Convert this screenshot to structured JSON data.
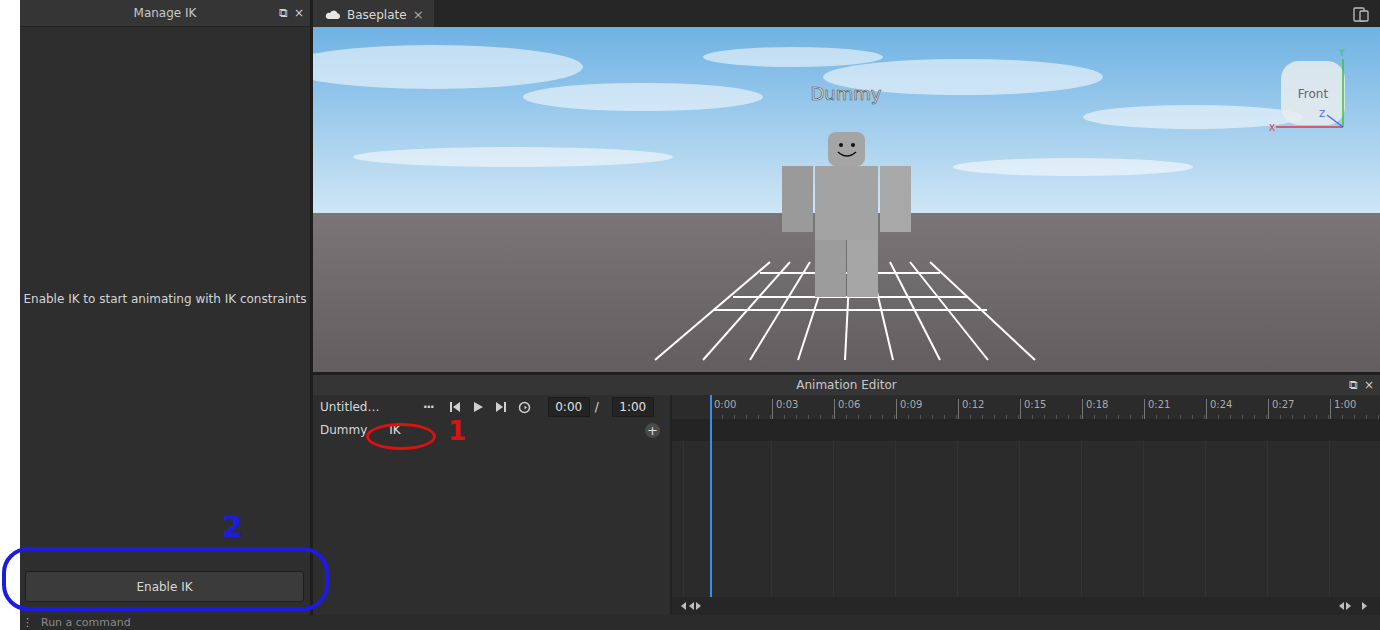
{
  "manage_ik": {
    "title": "Manage IK",
    "window_icons": [
      "⧉",
      "×"
    ],
    "message": "Enable IK to start animating with IK constraints",
    "button": "Enable IK"
  },
  "tabs": [
    {
      "label": "Baseplate",
      "selected": true,
      "close": "×"
    }
  ],
  "viewport": {
    "character_label": "Dummy",
    "view_cube": "Front",
    "axes": [
      {
        "label": "X",
        "color": "#e03a3a"
      },
      {
        "label": "Y",
        "color": "#3ac43a"
      },
      {
        "label": "Z",
        "color": "#4a6cf0"
      }
    ]
  },
  "animation_editor": {
    "title": "Animation Editor",
    "window_icons": [
      "⧉",
      "×"
    ],
    "animation_name": "Untitled…",
    "more": "···",
    "current_time": "0:00",
    "separator": "/",
    "end_time": "1:00",
    "ticks": [
      "0:00",
      "0:03",
      "0:06",
      "0:09",
      "0:12",
      "0:15",
      "0:18",
      "0:21",
      "0:24",
      "0:27",
      "1:00"
    ],
    "tracks": [
      {
        "name": "Dummy",
        "ik_label": "IK",
        "add": "+"
      }
    ]
  },
  "annotations": [
    {
      "label": "1",
      "color": "#e01010"
    },
    {
      "label": "2",
      "color": "#1c1ce0"
    }
  ],
  "command_bar": {
    "grip": "⋮",
    "placeholder": "Run a command"
  }
}
